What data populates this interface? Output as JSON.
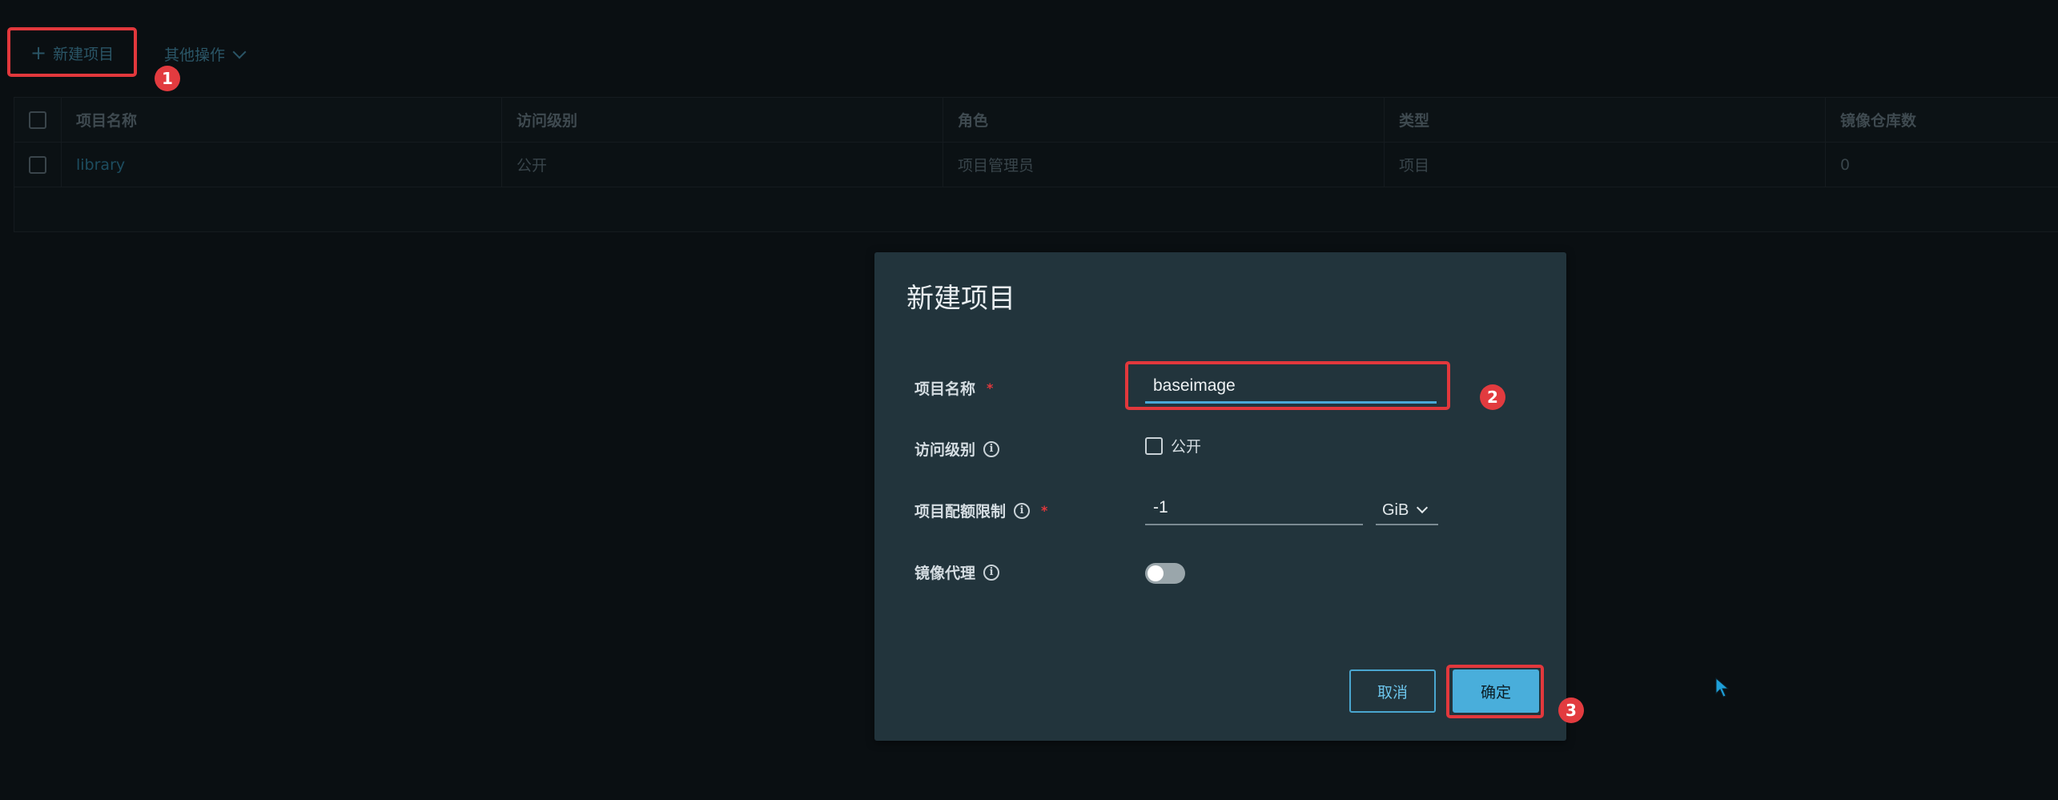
{
  "toolbar": {
    "new_project_icon": "+",
    "new_project_label": "新建项目",
    "other_actions_label": "其他操作"
  },
  "table": {
    "headers": [
      "项目名称",
      "访问级别",
      "角色",
      "类型",
      "镜像仓库数"
    ],
    "rows": [
      {
        "name": "library",
        "access": "公开",
        "role": "项目管理员",
        "type": "项目",
        "repos": "0"
      }
    ]
  },
  "modal": {
    "title": "新建项目",
    "name_label": "项目名称",
    "name_required": "*",
    "name_value": "baseimage",
    "access_label": "访问级别",
    "public_label": "公开",
    "quota_label": "项目配额限制",
    "quota_required": "*",
    "quota_value": "-1",
    "quota_unit": "GiB",
    "proxy_label": "镜像代理",
    "cancel_label": "取消",
    "ok_label": "确定",
    "info_icon": "i"
  },
  "annotations": {
    "step1": "1",
    "step2": "2",
    "step3": "3"
  },
  "colors": {
    "highlight": "#e2383c",
    "primary": "#49aedb",
    "modal_bg": "#22343c",
    "page_bg": "#0a0f12"
  }
}
